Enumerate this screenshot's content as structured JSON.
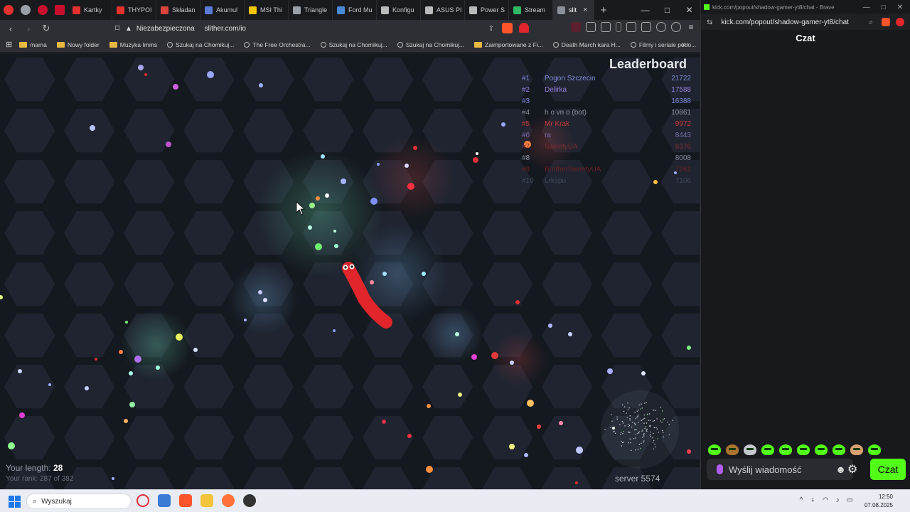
{
  "browser": {
    "tabs": [
      {
        "label": "Kartky",
        "color": "#e3312d"
      },
      {
        "label": "THYPOI",
        "color": "#e3312d"
      },
      {
        "label": "Składan",
        "color": "#d9453c"
      },
      {
        "label": "Akumul",
        "color": "#5a7bd8"
      },
      {
        "label": "MSI Thi",
        "color": "#f2c500"
      },
      {
        "label": "Triangle",
        "color": "#9aa0a8"
      },
      {
        "label": "Ford Mu",
        "color": "#4b8ad6"
      },
      {
        "label": "Konfigu",
        "color": "#bbbbbb"
      },
      {
        "label": "ASUS PI",
        "color": "#bbbbbb"
      },
      {
        "label": "Power S",
        "color": "#bbbbbb"
      },
      {
        "label": "Stream",
        "color": "#2fb866"
      },
      {
        "label": "slit",
        "color": "#8b9099",
        "active": true
      }
    ],
    "new_tab": "+",
    "insecure_label": "Niezabezpieczona",
    "url": "slither.com/io",
    "bookmarks": [
      {
        "label": "mama",
        "icon": "folder-icon"
      },
      {
        "label": "Nowy folder",
        "icon": "folder-icon"
      },
      {
        "label": "Muzyka Imms",
        "icon": "folder-icon"
      },
      {
        "label": "Szukaj na Chomikuj...",
        "icon": "pin-icon"
      },
      {
        "label": "The Free Orchestra...",
        "icon": "site-icon"
      },
      {
        "label": "Szukaj na Chomikuj...",
        "icon": "pin-icon"
      },
      {
        "label": "Szukaj na Chomikuj...",
        "icon": "pin-icon"
      },
      {
        "label": "Zaimportowane z Fi...",
        "icon": "folder-icon"
      },
      {
        "label": "Death March kara H...",
        "icon": "site-icon"
      },
      {
        "label": "Filmy i seriale podo...",
        "icon": "site-icon"
      }
    ],
    "more_bookmarks": "»"
  },
  "game": {
    "leaderboard_title": "Leaderboard",
    "leaderboard": [
      {
        "rank": "#1",
        "name": "Pogon Szczecin",
        "score": "21722",
        "color": "#7d8bd8"
      },
      {
        "rank": "#2",
        "name": "Delirka",
        "score": "17588",
        "color": "#9a7fe0"
      },
      {
        "rank": "#3",
        "name": "",
        "score": "16388",
        "color": "#7c8be0"
      },
      {
        "rank": "#4",
        "name": "h o vn  o  (bot)",
        "score": "10861",
        "color": "#8e8e9a"
      },
      {
        "rank": "#5",
        "name": "Mr Krak",
        "score": "9972",
        "color": "#c23a3a"
      },
      {
        "rank": "#6",
        "name": "ra",
        "score": "8443",
        "color": "#7e6ca8"
      },
      {
        "rank": "#7",
        "name": "SweetyUA",
        "score": "8376",
        "color": "#7a2c30"
      },
      {
        "rank": "#8",
        "name": "",
        "score": "8008",
        "color": "#8a8ea0"
      },
      {
        "rank": "#9",
        "name": "BrotherSweetyUA",
        "score": "7261",
        "color": "#6a2025"
      },
      {
        "rank": "#10",
        "name": "Lrkspu",
        "score": "7106",
        "color": "#404a5a"
      }
    ],
    "length_label": "Your length:",
    "length_value": "28",
    "rank_text": "Your rank: 287 of 382",
    "server": "server 5574"
  },
  "chat": {
    "window_title": "kick.com/popout/shadow-gamer-yt8/chat - Brave",
    "url": "kick.com/popout/shadow-gamer-yt8/chat",
    "title": "Czat",
    "input_placeholder": "Wyślij wiadomość",
    "send_label": "Czat"
  },
  "taskbar": {
    "search_placeholder": "Wyszukaj",
    "time": "12:50",
    "date": "07.08.2025"
  },
  "colors": {
    "kick_green": "#53fc18",
    "snake_red": "#e0262b",
    "game_bg": "#14181f"
  }
}
